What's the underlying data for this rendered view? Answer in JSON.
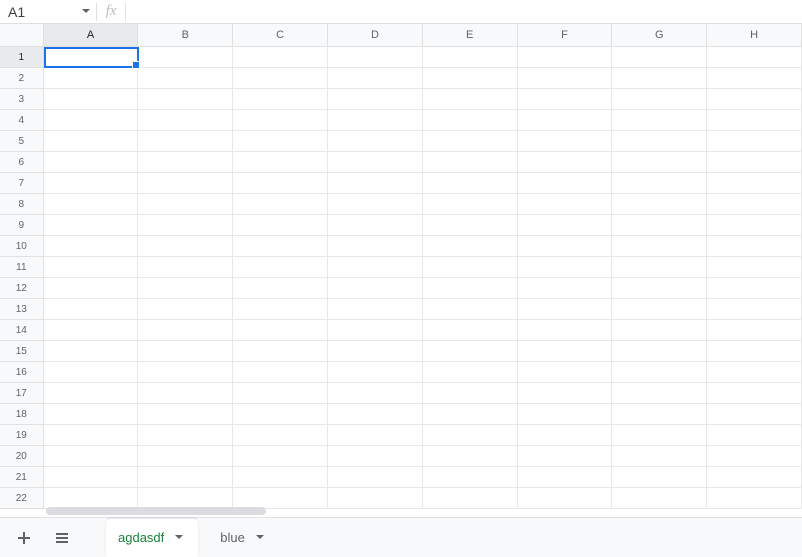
{
  "nameBox": {
    "value": "A1"
  },
  "formula": {
    "value": "",
    "fxLabel": "fx"
  },
  "columns": [
    "A",
    "B",
    "C",
    "D",
    "E",
    "F",
    "G",
    "H"
  ],
  "rowCount": 22,
  "selection": {
    "col": "A",
    "row": 1
  },
  "sheetTabs": [
    {
      "name": "agdasdf",
      "active": true
    },
    {
      "name": "blue",
      "active": false
    }
  ]
}
